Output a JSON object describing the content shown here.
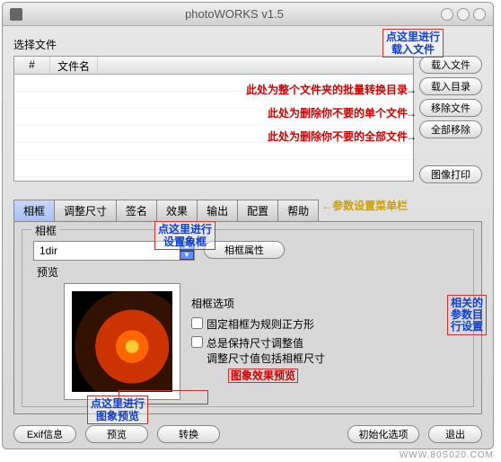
{
  "window": {
    "title": "photoWORKS v1.5"
  },
  "callouts": {
    "load_file": "点这里进行\n载入文件",
    "batch_dir": "此处为整个文件夹的批量转换目录",
    "remove_one": "此处为删除你不要的单个文件",
    "remove_all": "此处为删除你不要的全部文件",
    "tab_note": "参数设置菜单栏",
    "set_frame": "点这里进行\n设置象框",
    "img_effect": "图象效果预览",
    "img_preview": "点这里进行\n图象预览",
    "right_opts": "相关的\n参数目\n行设置"
  },
  "labels": {
    "select_file": "选择文件",
    "col_num": "#",
    "col_name": "文件名",
    "frame_group": "相框",
    "preview": "预览",
    "frame_options": "相框选项"
  },
  "side_buttons": {
    "load_file": "载入文件",
    "load_dir": "载入目录",
    "remove_file": "移除文件",
    "remove_all": "全部移除",
    "print": "图像打印"
  },
  "tabs": {
    "frame": "相框",
    "resize": "调整尺寸",
    "sign": "签名",
    "effect": "效果",
    "output": "输出",
    "config": "配置",
    "help": "帮助"
  },
  "frame": {
    "dropdown_value": "1dir",
    "attr_btn": "相框属性",
    "opt_fixed": "固定相框为规则正方形",
    "opt_keep": "总是保持尺寸调整值\n调整尺寸值包括相框尺寸"
  },
  "bottom": {
    "exif": "Exif信息",
    "preview": "预览",
    "convert": "转换",
    "init": "初始化选项",
    "exit": "退出"
  },
  "watermark": "WWW.80S020.COM"
}
